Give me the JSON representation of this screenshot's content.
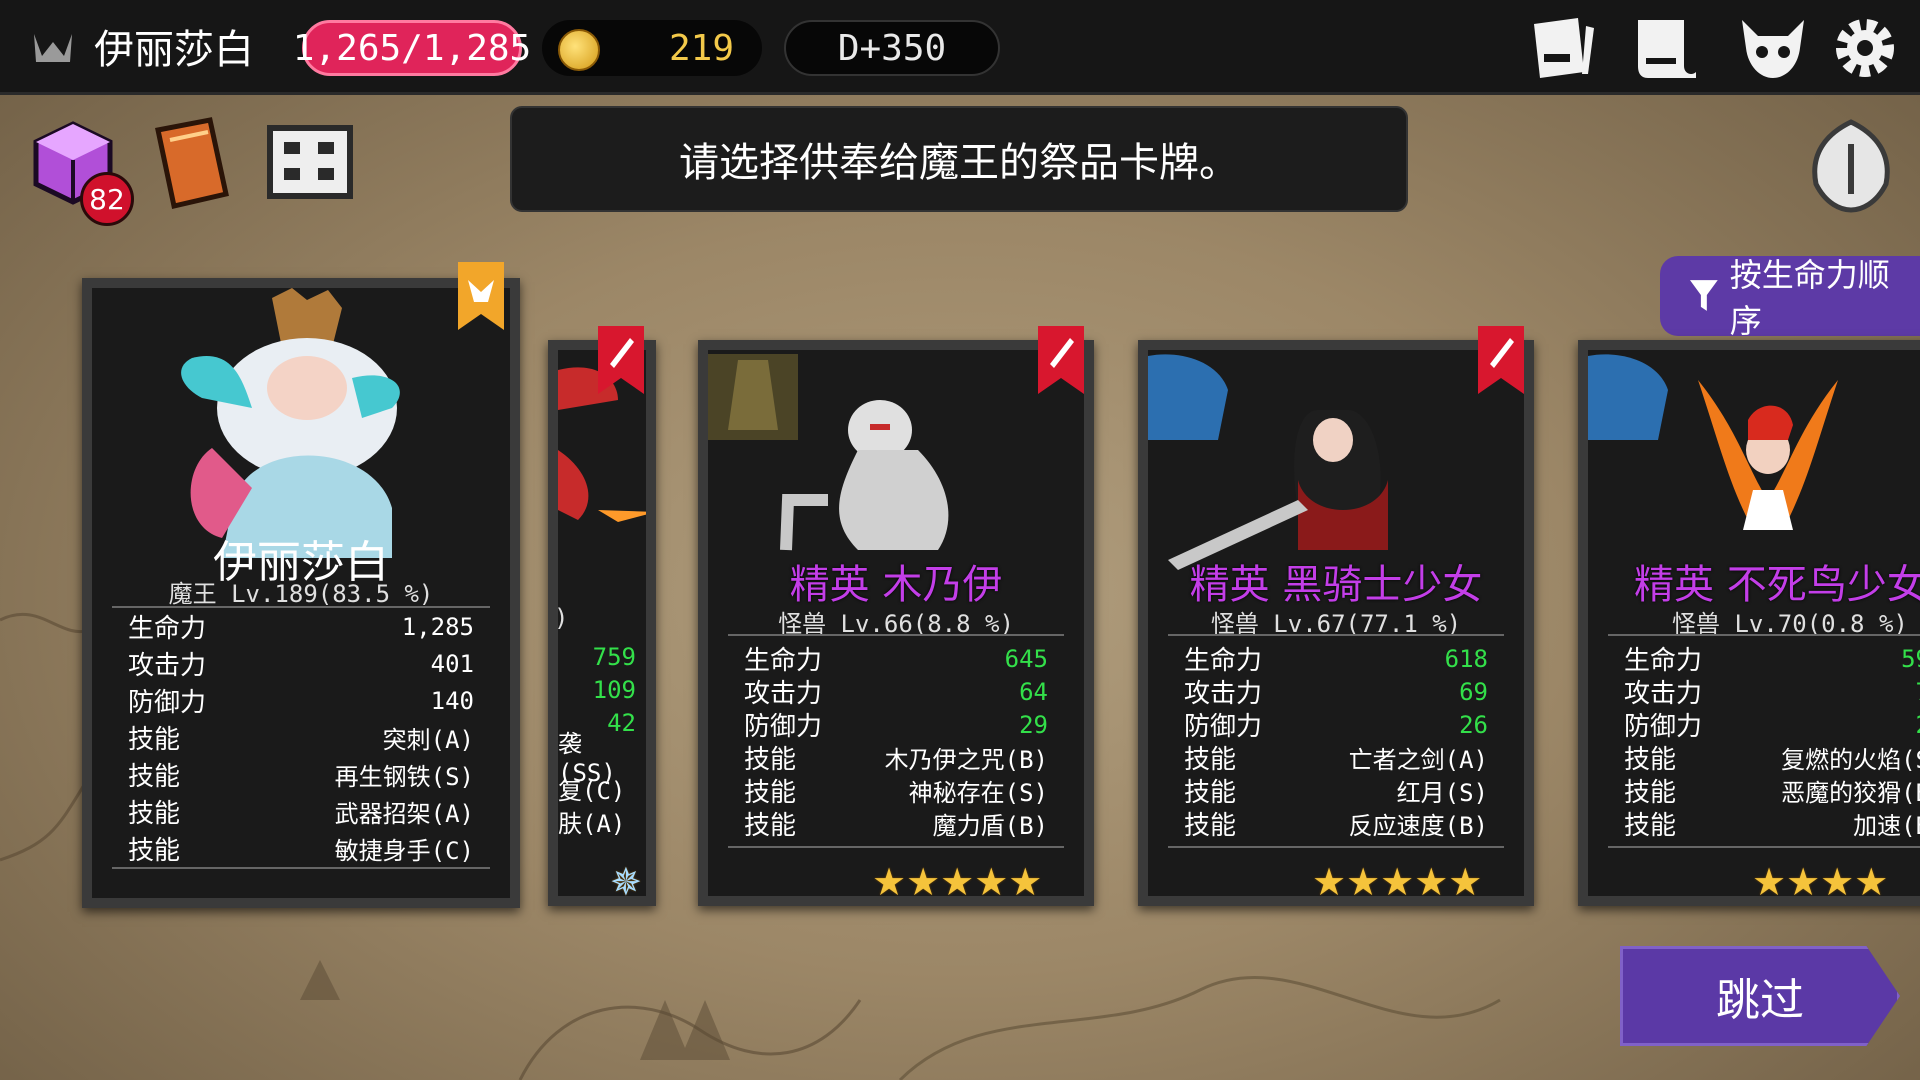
{
  "header": {
    "player_name": "伊丽莎白",
    "hp": "1,265/1,285",
    "gold": "219",
    "day": "D+350",
    "icons": [
      "card-icon",
      "scroll-icon",
      "demon-skull-icon",
      "gear-icon"
    ]
  },
  "toolbar": {
    "items": [
      {
        "name": "cube-icon",
        "badge": "82"
      },
      {
        "name": "book-icon"
      },
      {
        "name": "map-scroll-icon"
      }
    ]
  },
  "prompt": "请选择供奉给魔王的祭品卡牌。",
  "sort_label": "按生命力顺序",
  "skip_label": "跳过",
  "stat_labels": {
    "hp": "生命力",
    "atk": "攻击力",
    "def": "防御力",
    "skill": "技能"
  },
  "cards": [
    {
      "name": "伊丽莎白",
      "sub": "魔王 Lv.189(83.5 %)",
      "hp": "1,285",
      "atk": "401",
      "def": "140",
      "skills": [
        "突刺(A)",
        "再生钢铁(S)",
        "武器招架(A)",
        "敏捷身手(C)"
      ]
    },
    {
      "name": "",
      "sub": ")",
      "hp": "759",
      "atk": "109",
      "def": "42",
      "skills": [
        "袭(SS)",
        "复(C)",
        "肤(A)"
      ],
      "stars": "✵"
    },
    {
      "name": "精英  木乃伊",
      "sub": "怪兽 Lv.66(8.8 %)",
      "hp": "645",
      "atk": "64",
      "def": "29",
      "skills": [
        "木乃伊之咒(B)",
        "神秘存在(S)",
        "魔力盾(B)"
      ],
      "stars": "★★★★★"
    },
    {
      "name": "精英  黑骑士少女",
      "sub": "怪兽 Lv.67(77.1 %)",
      "hp": "618",
      "atk": "69",
      "def": "26",
      "skills": [
        "亡者之剑(A)",
        "红月(S)",
        "反应速度(B)"
      ],
      "stars": "★★★★★"
    },
    {
      "name": "精英  不死鸟少女",
      "sub": "怪兽 Lv.70(0.8 %)",
      "hp": "59",
      "atk": "7",
      "def": "2",
      "skills": [
        "复燃的火焰(S",
        "恶魔的狡猾(B",
        "加速(B"
      ],
      "stars": "★★★★"
    }
  ]
}
